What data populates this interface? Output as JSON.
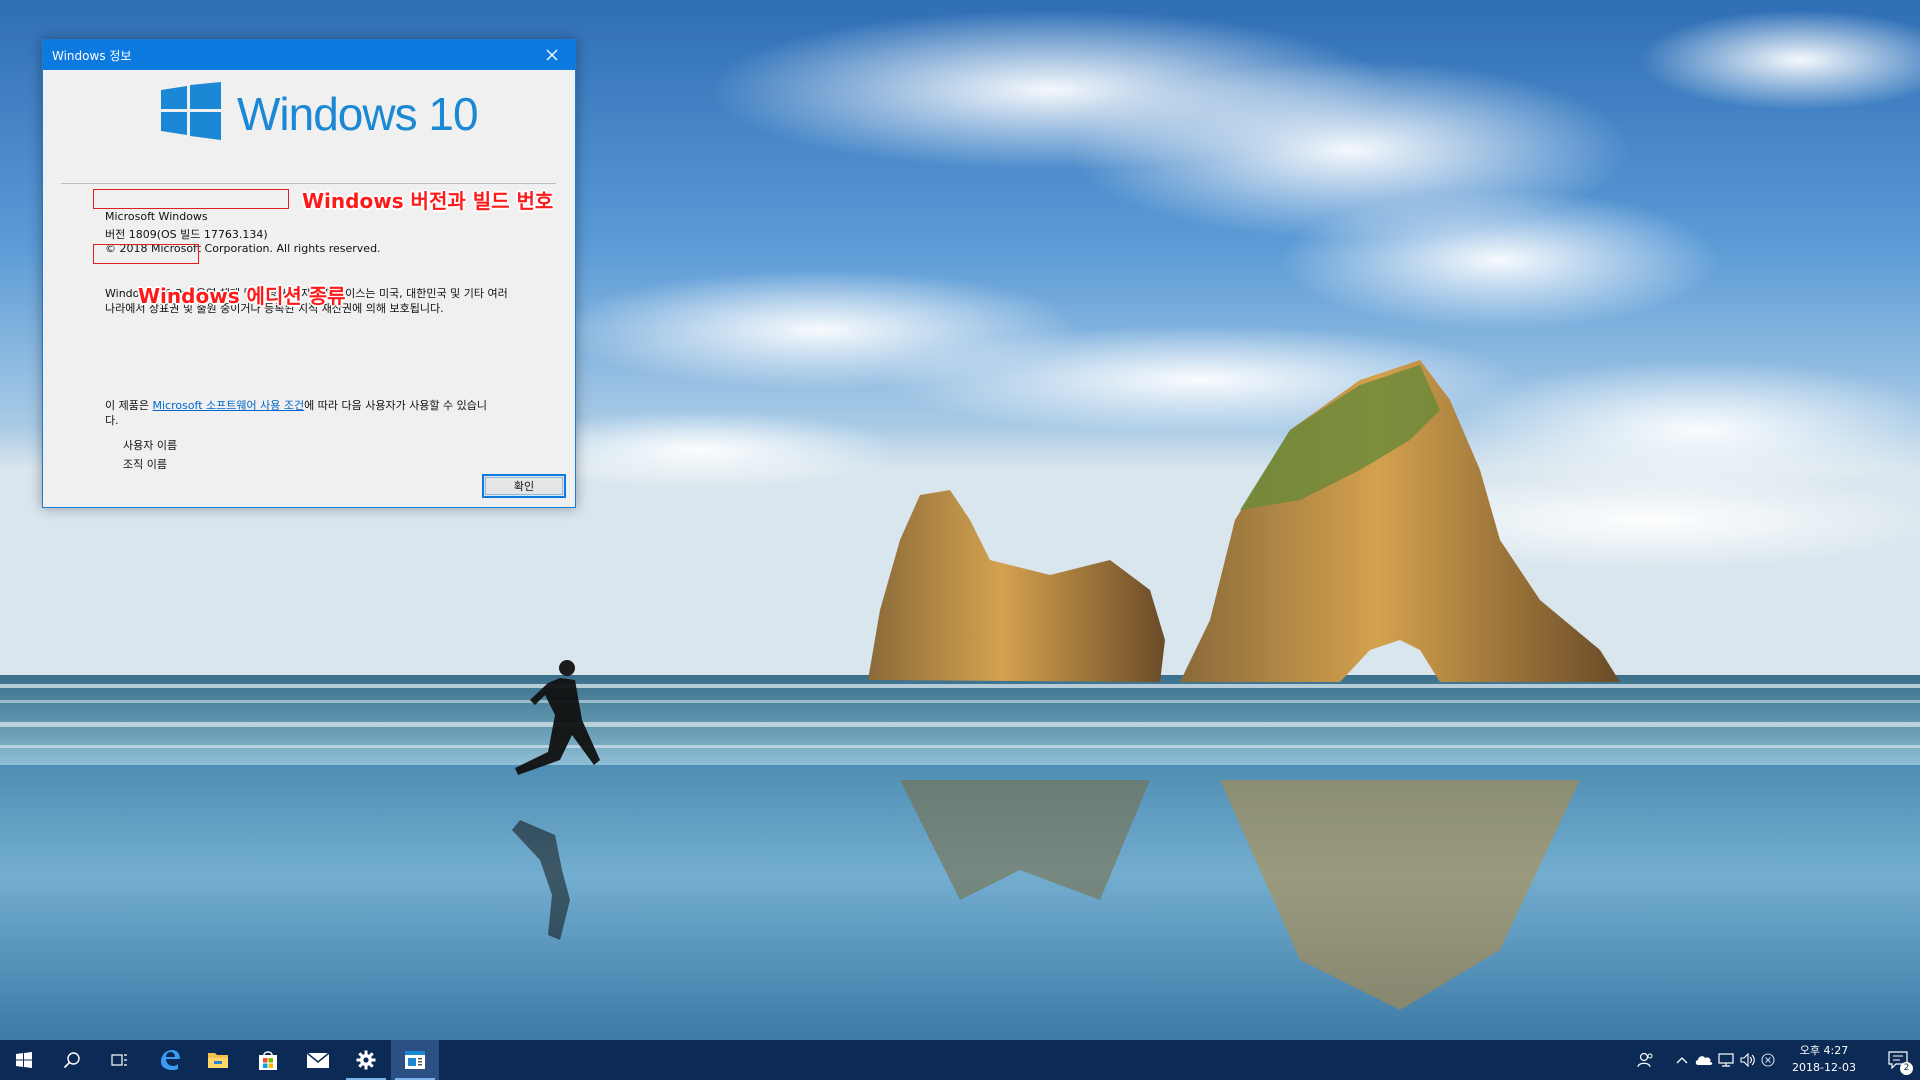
{
  "dialog": {
    "title": "Windows 정보",
    "logo_text": "Windows 10",
    "product_name": "Microsoft Windows",
    "version_line": "버전 1809(OS 빌드 17763.134)",
    "copyright": "© 2018 Microsoft Corporation. All rights reserved.",
    "edition": "Windows 10 Pro",
    "legal_text": " 운영 체제 및 해당 사용자 인터페이스는 미국, 대한민국 및 기타 여러 나라에서 상표권 및 출원 중이거나 등록된 지적 재산권에 의해 보호됩니다.",
    "license_prefix": "이 제품은 ",
    "license_link": "Microsoft 소프트웨어 사용 조건",
    "license_suffix": "에 따라 다음 사용자가 사용할 수 있습니다.",
    "user_name_label": "사용자 이름",
    "org_name_label": "조직 이름",
    "ok_label": "확인"
  },
  "annotations": {
    "version_note": "Windows 버전과 빌드 번호",
    "edition_note": "Windows 에디션 종류",
    "color": "#ff1a1a"
  },
  "taskbar": {
    "pinned": [
      "start-icon",
      "search-icon",
      "task-view-icon",
      "edge-icon",
      "file-explorer-icon",
      "store-icon",
      "mail-icon",
      "settings-icon",
      "winver-icon"
    ],
    "tray": [
      "people-icon",
      "show-hidden-icons-chevron",
      "onedrive-icon",
      "network-icon",
      "volume-icon",
      "error-icon"
    ],
    "clock_time": "오후 4:27",
    "clock_date": "2018-12-03",
    "notification_count": "2",
    "background_color": "#0b2a55"
  }
}
